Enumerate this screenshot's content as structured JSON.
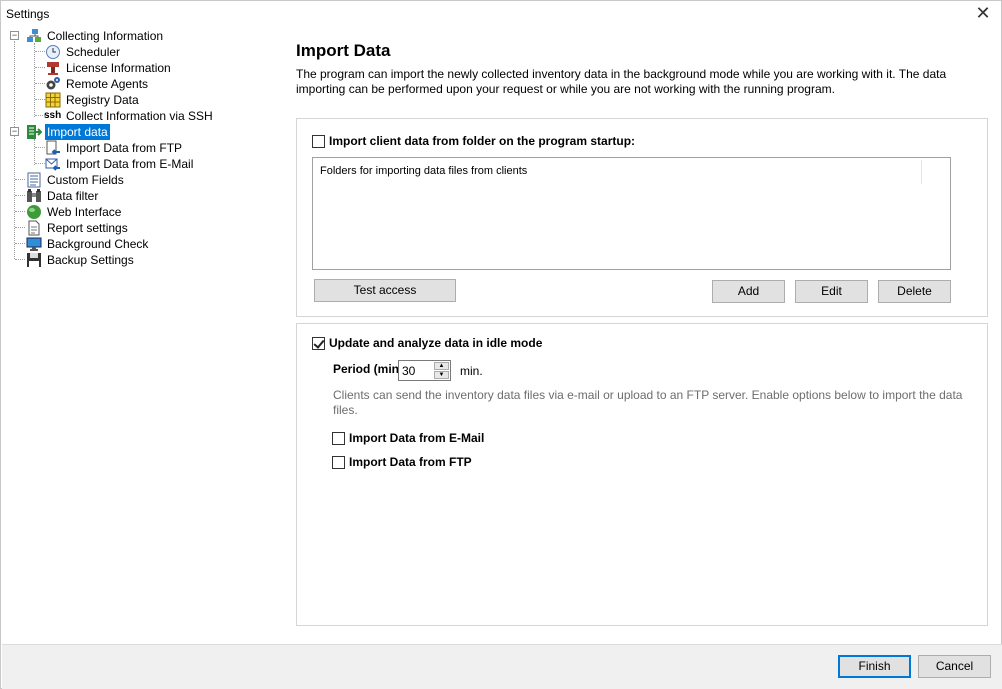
{
  "window": {
    "title": "Settings",
    "close_glyph": "✕"
  },
  "tree": {
    "items": [
      {
        "label": "Collecting Information",
        "icon": "network-icon"
      },
      {
        "label": "Scheduler",
        "icon": "clock-icon"
      },
      {
        "label": "License Information",
        "icon": "stamp-icon"
      },
      {
        "label": "Remote Agents",
        "icon": "gears-icon"
      },
      {
        "label": "Registry Data",
        "icon": "grid-icon"
      },
      {
        "label": "Collect Information via SSH",
        "icon": "ssh-icon",
        "icon_text": "ssh"
      },
      {
        "label": "Import data",
        "icon": "import-icon"
      },
      {
        "label": "Import Data from FTP",
        "icon": "ftp-import-icon"
      },
      {
        "label": "Import Data from E-Mail",
        "icon": "email-import-icon"
      },
      {
        "label": "Custom Fields",
        "icon": "list-icon"
      },
      {
        "label": "Data filter",
        "icon": "filter-icon"
      },
      {
        "label": "Web Interface",
        "icon": "globe-icon"
      },
      {
        "label": "Report settings",
        "icon": "report-icon"
      },
      {
        "label": "Background Check",
        "icon": "monitor-icon"
      },
      {
        "label": "Backup Settings",
        "icon": "floppy-icon"
      }
    ]
  },
  "main": {
    "heading": "Import Data",
    "description": "The program can import the newly collected inventory data in the background mode while you are working with it. The data importing can be performed upon your request or while you are not working with the running program.",
    "startup_group": {
      "checkbox_label": "Import client data from folder on the program startup:",
      "checked": false,
      "list_header": "Folders for importing data files from clients",
      "test_button": "Test access",
      "add_button": "Add",
      "edit_button": "Edit",
      "delete_button": "Delete"
    },
    "idle_group": {
      "checkbox_label": "Update and analyze data in idle mode",
      "checked": true,
      "period_label": "Period (min",
      "period_value": "30",
      "period_unit": "min.",
      "info": "Clients can send the inventory data files via e-mail or upload to an FTP server. Enable options below to import the data files.",
      "email_label": "Import Data from E-Mail",
      "email_checked": false,
      "ftp_label": "Import Data from FTP",
      "ftp_checked": false
    }
  },
  "footer": {
    "finish_button": "Finish",
    "cancel_button": "Cancel"
  },
  "colors": {
    "selection": "#0078d7",
    "button_face": "#e1e1e1",
    "default_border": "#0078d7"
  }
}
